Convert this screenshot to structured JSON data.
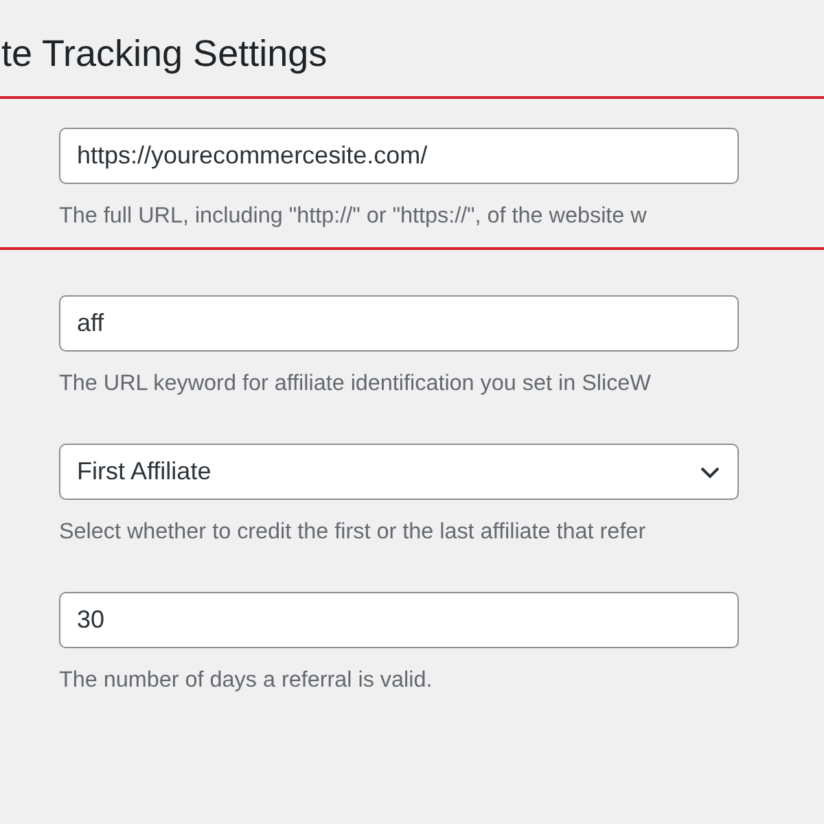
{
  "heading": "te Tracking Settings",
  "fields": [
    {
      "kind": "text",
      "value": "https://yourecommercesite.com/",
      "description": "The full URL, including \"http://\" or \"https://\", of the website w",
      "highlighted": true
    },
    {
      "kind": "text",
      "value": "aff",
      "description": "The URL keyword for affiliate identification you set in SliceW",
      "highlighted": false
    },
    {
      "kind": "select",
      "value": "First Affiliate",
      "description": "Select whether to credit the first or the last affiliate that refer",
      "highlighted": false
    },
    {
      "kind": "text",
      "value": "30",
      "description": "The number of days a referral is valid.",
      "highlighted": false
    }
  ]
}
